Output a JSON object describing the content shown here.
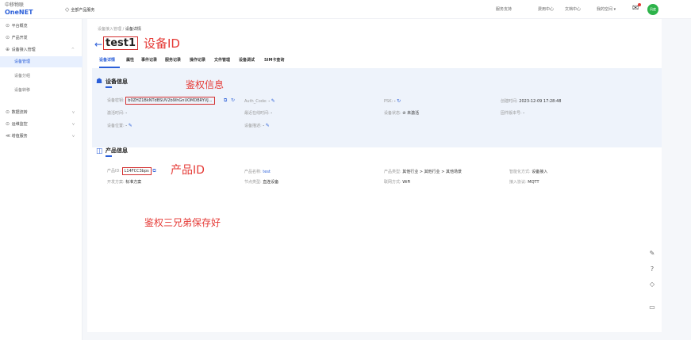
{
  "topbar": {
    "logo_line1": "中移物联",
    "logo_line2": "OneNET",
    "all_products": "全部产品服务",
    "links": [
      "服务支持",
      "费用中心",
      "文档中心",
      "我的空间 ▾"
    ],
    "avatar_text": "风度"
  },
  "sidebar": {
    "items": [
      {
        "icon": "⊙",
        "label": "平台概览"
      },
      {
        "icon": "⊙",
        "label": "产品开发"
      },
      {
        "icon": "⊕",
        "label": "设备接入管理",
        "arrow": "^"
      },
      {
        "label": "设备管理",
        "active": true
      },
      {
        "label": "设备分组"
      },
      {
        "label": "设备转移"
      },
      {
        "icon": "⊙",
        "label": "数据流转",
        "arrow": "v"
      },
      {
        "icon": "⊙",
        "label": "运维监控",
        "arrow": "v"
      },
      {
        "icon": "≪",
        "label": "增值服务",
        "arrow": "v"
      }
    ]
  },
  "breadcrumb": {
    "root": "设备接入管理",
    "sep": "/",
    "current": "设备详情"
  },
  "device": {
    "back_glyph": "←",
    "name": "test1"
  },
  "annotations": {
    "device_id": "设备ID",
    "auth_info": "鉴权信息",
    "product_id": "产品ID",
    "bottom_note": "鉴权三兄弟保存好"
  },
  "tabs": [
    "设备详情",
    "属性",
    "事件记录",
    "服务记录",
    "操作记录",
    "文件管理",
    "设备调试",
    "SIM卡查询"
  ],
  "device_info": {
    "title": "设备信息",
    "fields": {
      "secret_label": "设备密钥:",
      "secret_value": "b0ZHZ1BkNTdBSUV2b9lhGnUOMDBRYVJ...",
      "auth_code_label": "Auth_Code:",
      "auth_code_value": "-",
      "psk_label": "PSK:",
      "psk_value": "-",
      "created_label": "创建时间:",
      "created_value": "2023-12-09 17:28:48",
      "active_label": "激活时间:",
      "active_value": "-",
      "last_online_label": "最近在线时间:",
      "last_online_value": "-",
      "status_label": "设备状态:",
      "status_value": "未激活",
      "firmware_label": "固件版本号:",
      "firmware_value": "-",
      "location_label": "设备位置:",
      "location_value": "-",
      "desc_label": "设备描述:",
      "desc_value": "-"
    }
  },
  "product_info": {
    "title": "产品信息",
    "fields": {
      "pid_label": "产品ID:",
      "pid_value": "L14FCC3bps",
      "pname_label": "产品名称:",
      "pname_value": "test",
      "ptype_label": "产品类型:",
      "ptype_value": "其他行业 > 其他行业 > 其他场景",
      "smart_label": "智能化方式:",
      "smart_value": "设备接入",
      "dev_label": "开发方案:",
      "dev_value": "标准方案",
      "node_label": "节点类型:",
      "node_value": "直连设备",
      "net_label": "联网方式:",
      "net_value": "WiFi",
      "proto_label": "接入协议:",
      "proto_value": "MQTT"
    }
  },
  "right_tools": [
    "edit-icon",
    "help-icon",
    "locate-icon",
    "message-icon"
  ]
}
